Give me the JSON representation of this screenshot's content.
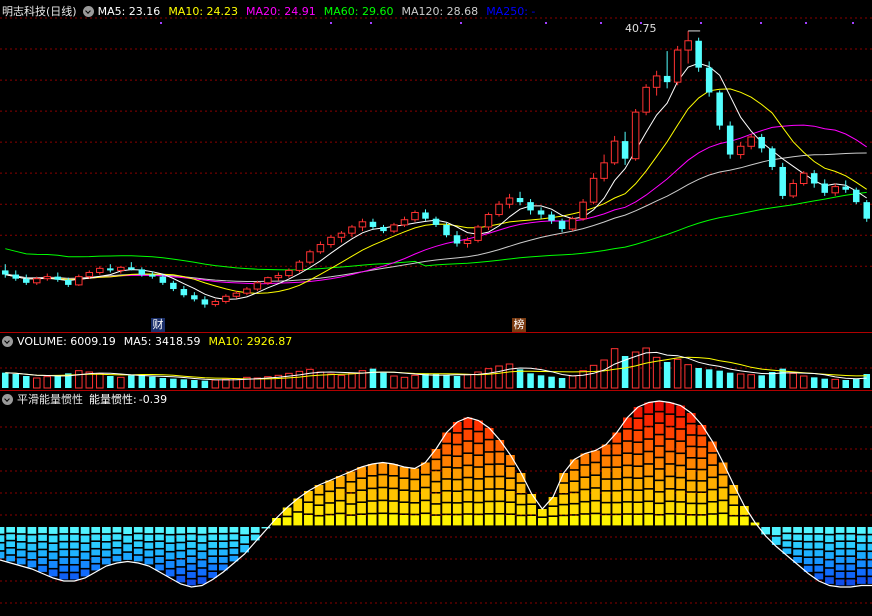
{
  "price_panel": {
    "title": "明志科技(日线)",
    "indicators": [
      {
        "label": "MA5:",
        "value": "23.16",
        "color": "#ffffff"
      },
      {
        "label": "MA10:",
        "value": "24.23",
        "color": "#ffff00"
      },
      {
        "label": "MA20:",
        "value": "24.91",
        "color": "#ff00ff"
      },
      {
        "label": "MA60:",
        "value": "29.60",
        "color": "#00ff00"
      },
      {
        "label": "MA120:",
        "value": "28.68",
        "color": "#cccccc"
      },
      {
        "label": "MA250:",
        "value": "-",
        "color": "#0000ff"
      }
    ],
    "high_label": "40.75",
    "markers": [
      {
        "text": "财",
        "style": "fin"
      },
      {
        "text": "榜",
        "style": "board"
      }
    ]
  },
  "volume_panel": {
    "indicators": [
      {
        "label": "VOLUME:",
        "value": "6009.19",
        "color": "#ffffff"
      },
      {
        "label": "MA5:",
        "value": "3418.59",
        "color": "#ffffff"
      },
      {
        "label": "MA10:",
        "value": "2926.87",
        "color": "#ffff00"
      }
    ]
  },
  "energy_panel": {
    "title": "平滑能量惯性",
    "indicator_label": "能量惯性:",
    "indicator_value": "-0.39"
  },
  "colors": {
    "up": "#ff3232",
    "down": "#54ffff",
    "grid": "#8a0000",
    "ma5": "#ffffff",
    "ma10": "#ffff00",
    "ma20": "#ff00ff",
    "ma60": "#00ff00",
    "ma120": "#cccccc"
  },
  "chart_data": {
    "type": "candlestick",
    "price_range": [
      13,
      42
    ],
    "high_value": 40.75,
    "ohlc": [
      [
        17.6,
        18.2,
        16.9,
        17.2
      ],
      [
        17.2,
        17.6,
        16.6,
        16.8
      ],
      [
        16.8,
        17.2,
        16.2,
        16.4
      ],
      [
        16.4,
        17.0,
        16.2,
        16.8
      ],
      [
        16.8,
        17.3,
        16.6,
        17.0
      ],
      [
        17.0,
        17.4,
        16.5,
        16.7
      ],
      [
        16.7,
        16.9,
        16.0,
        16.2
      ],
      [
        16.2,
        17.2,
        16.1,
        17.0
      ],
      [
        17.0,
        17.6,
        16.8,
        17.4
      ],
      [
        17.4,
        18.0,
        17.2,
        17.8
      ],
      [
        17.8,
        18.2,
        17.4,
        17.6
      ],
      [
        17.6,
        18.0,
        17.3,
        17.9
      ],
      [
        17.9,
        18.4,
        17.6,
        17.7
      ],
      [
        17.7,
        17.9,
        17.0,
        17.2
      ],
      [
        17.2,
        17.5,
        16.8,
        17.0
      ],
      [
        17.0,
        17.2,
        16.2,
        16.4
      ],
      [
        16.4,
        16.6,
        15.6,
        15.8
      ],
      [
        15.8,
        16.1,
        15.0,
        15.2
      ],
      [
        15.2,
        15.5,
        14.6,
        14.8
      ],
      [
        14.8,
        15.1,
        14.0,
        14.3
      ],
      [
        14.3,
        14.8,
        14.1,
        14.6
      ],
      [
        14.6,
        15.3,
        14.4,
        15.1
      ],
      [
        15.1,
        15.6,
        14.9,
        15.4
      ],
      [
        15.4,
        16.0,
        15.2,
        15.8
      ],
      [
        15.8,
        16.6,
        15.6,
        16.4
      ],
      [
        16.4,
        17.0,
        16.2,
        16.9
      ],
      [
        16.9,
        17.4,
        16.6,
        17.1
      ],
      [
        17.1,
        17.8,
        16.9,
        17.6
      ],
      [
        17.6,
        18.6,
        17.4,
        18.4
      ],
      [
        18.4,
        19.6,
        18.2,
        19.4
      ],
      [
        19.4,
        20.4,
        19.2,
        20.1
      ],
      [
        20.1,
        21.0,
        19.8,
        20.8
      ],
      [
        20.8,
        21.4,
        20.3,
        21.2
      ],
      [
        21.2,
        22.0,
        20.8,
        21.8
      ],
      [
        21.8,
        22.6,
        21.4,
        22.3
      ],
      [
        22.3,
        22.6,
        21.6,
        21.8
      ],
      [
        21.8,
        22.0,
        21.2,
        21.4
      ],
      [
        21.4,
        22.2,
        21.2,
        22.0
      ],
      [
        22.0,
        22.8,
        21.8,
        22.5
      ],
      [
        22.5,
        23.4,
        22.3,
        23.2
      ],
      [
        23.2,
        23.5,
        22.4,
        22.6
      ],
      [
        22.6,
        22.8,
        21.8,
        22.0
      ],
      [
        22.0,
        22.2,
        20.8,
        21.0
      ],
      [
        21.0,
        21.4,
        19.9,
        20.2
      ],
      [
        20.2,
        20.8,
        19.8,
        20.5
      ],
      [
        20.5,
        22.0,
        20.3,
        21.8
      ],
      [
        21.8,
        23.2,
        21.5,
        23.0
      ],
      [
        23.0,
        24.3,
        22.8,
        24.0
      ],
      [
        24.0,
        25.0,
        23.6,
        24.6
      ],
      [
        24.6,
        25.2,
        23.9,
        24.2
      ],
      [
        24.2,
        24.5,
        23.0,
        23.4
      ],
      [
        23.4,
        23.7,
        22.6,
        23.0
      ],
      [
        23.0,
        23.3,
        22.1,
        22.4
      ],
      [
        22.4,
        22.6,
        21.3,
        21.6
      ],
      [
        21.6,
        22.8,
        21.4,
        22.6
      ],
      [
        22.6,
        24.5,
        22.4,
        24.2
      ],
      [
        24.2,
        27.0,
        24.0,
        26.5
      ],
      [
        26.5,
        28.8,
        26.2,
        28.0
      ],
      [
        28.0,
        30.6,
        27.8,
        30.1
      ],
      [
        30.1,
        31.0,
        27.8,
        28.4
      ],
      [
        28.4,
        33.2,
        28.2,
        32.9
      ],
      [
        32.9,
        35.6,
        32.6,
        35.3
      ],
      [
        35.3,
        36.9,
        34.5,
        36.4
      ],
      [
        36.4,
        38.8,
        35.2,
        35.8
      ],
      [
        35.8,
        39.3,
        35.5,
        38.9
      ],
      [
        38.9,
        40.75,
        37.6,
        39.8
      ],
      [
        39.8,
        40.1,
        36.8,
        37.2
      ],
      [
        37.2,
        37.8,
        34.4,
        34.8
      ],
      [
        34.8,
        35.0,
        31.2,
        31.6
      ],
      [
        31.6,
        32.0,
        28.4,
        28.8
      ],
      [
        28.8,
        30.0,
        28.4,
        29.6
      ],
      [
        29.6,
        30.8,
        29.3,
        30.5
      ],
      [
        30.5,
        30.8,
        29.0,
        29.4
      ],
      [
        29.4,
        29.6,
        27.3,
        27.6
      ],
      [
        27.6,
        28.0,
        24.5,
        24.8
      ],
      [
        24.8,
        26.4,
        24.6,
        26.0
      ],
      [
        26.0,
        27.2,
        25.8,
        27.0
      ],
      [
        27.0,
        27.3,
        25.6,
        26.0
      ],
      [
        26.0,
        26.4,
        24.8,
        25.1
      ],
      [
        25.1,
        26.0,
        24.8,
        25.7
      ],
      [
        25.7,
        26.3,
        25.1,
        25.4
      ],
      [
        25.4,
        25.6,
        24.0,
        24.2
      ],
      [
        24.2,
        24.4,
        22.3,
        22.6
      ]
    ],
    "volume": [
      2.3,
      2.1,
      1.8,
      1.5,
      1.7,
      1.9,
      2.2,
      2.6,
      2.4,
      2.1,
      1.8,
      1.6,
      1.9,
      2.0,
      1.7,
      1.5,
      1.4,
      1.3,
      1.2,
      1.1,
      1.2,
      1.3,
      1.4,
      1.6,
      1.5,
      1.7,
      1.9,
      2.2,
      2.5,
      2.8,
      2.4,
      2.1,
      1.9,
      2.2,
      2.6,
      2.9,
      2.3,
      1.8,
      1.6,
      1.9,
      2.2,
      2.1,
      1.9,
      1.8,
      2.0,
      2.4,
      2.9,
      3.3,
      3.6,
      2.8,
      2.2,
      1.9,
      1.7,
      1.5,
      1.8,
      2.6,
      3.4,
      4.2,
      5.9,
      4.8,
      5.4,
      6.0,
      4.6,
      3.9,
      4.3,
      3.5,
      3.0,
      2.8,
      2.6,
      2.3,
      2.1,
      2.0,
      1.9,
      2.4,
      2.9,
      2.2,
      1.8,
      1.6,
      1.4,
      1.3,
      1.2,
      1.4,
      2.1
    ],
    "energy": [
      -0.22,
      -0.24,
      -0.26,
      -0.28,
      -0.31,
      -0.34,
      -0.36,
      -0.36,
      -0.34,
      -0.3,
      -0.26,
      -0.24,
      -0.23,
      -0.24,
      -0.26,
      -0.3,
      -0.34,
      -0.38,
      -0.4,
      -0.39,
      -0.35,
      -0.3,
      -0.24,
      -0.18,
      -0.1,
      -0.02,
      0.06,
      0.13,
      0.19,
      0.24,
      0.28,
      0.31,
      0.34,
      0.37,
      0.4,
      0.42,
      0.43,
      0.42,
      0.4,
      0.39,
      0.43,
      0.52,
      0.63,
      0.7,
      0.73,
      0.71,
      0.66,
      0.58,
      0.48,
      0.36,
      0.22,
      0.12,
      0.2,
      0.36,
      0.45,
      0.49,
      0.51,
      0.55,
      0.63,
      0.73,
      0.8,
      0.83,
      0.84,
      0.83,
      0.81,
      0.76,
      0.68,
      0.57,
      0.43,
      0.28,
      0.14,
      0.03,
      -0.06,
      -0.13,
      -0.19,
      -0.25,
      -0.31,
      -0.36,
      -0.39,
      -0.4,
      -0.4,
      -0.39,
      -0.39
    ]
  }
}
